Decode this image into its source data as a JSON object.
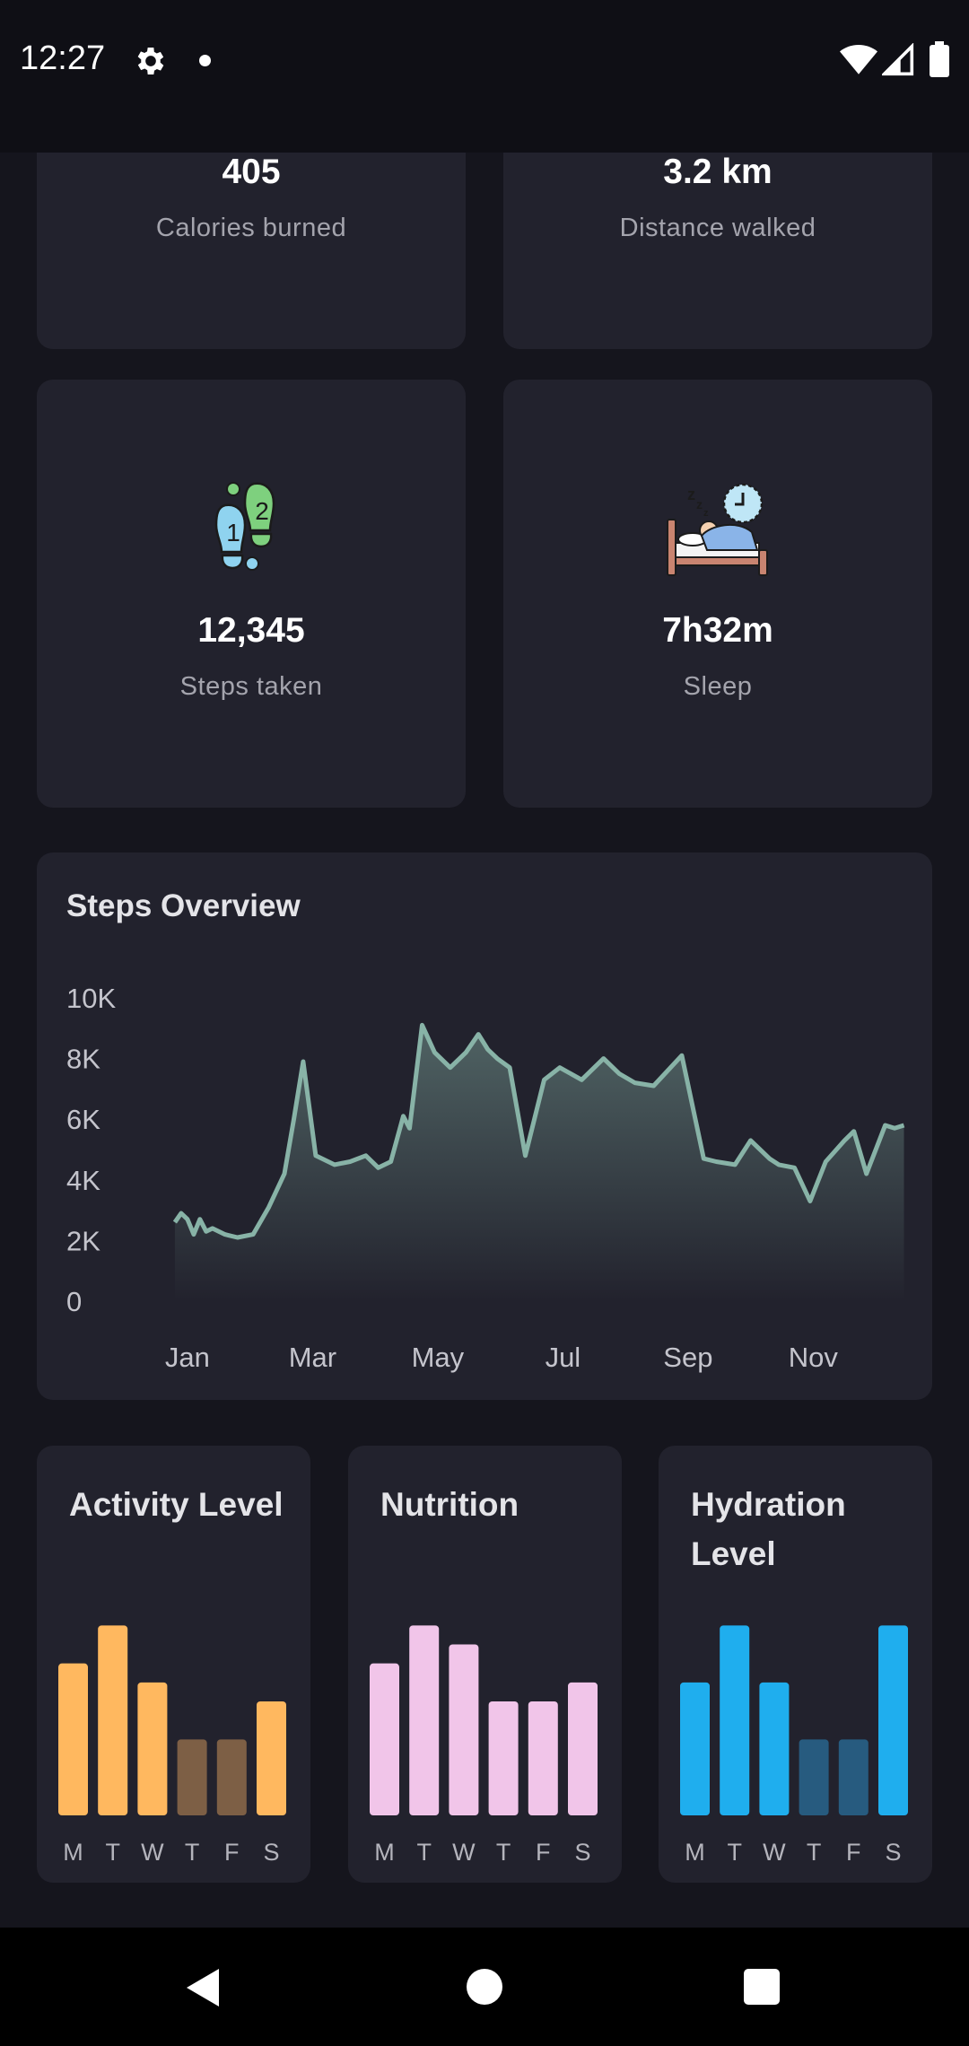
{
  "status_bar": {
    "time": "12:27",
    "icons": [
      "gear-icon",
      "notification-dot",
      "wifi-icon",
      "signal-icon",
      "battery-icon"
    ]
  },
  "stats": {
    "calories": {
      "value": "405",
      "label": "Calories burned"
    },
    "distance": {
      "value": "3.2 km",
      "label": "Distance walked"
    },
    "steps": {
      "value": "12,345",
      "label": "Steps taken",
      "icon": "footsteps-icon"
    },
    "sleep": {
      "value": "7h32m",
      "label": "Sleep",
      "icon": "sleep-bed-icon"
    }
  },
  "steps_overview": {
    "title": "Steps Overview",
    "chart_data": {
      "type": "area",
      "ylim": [
        0,
        10000
      ],
      "y_ticks": [
        0,
        2000,
        4000,
        6000,
        8000,
        10000
      ],
      "y_tick_labels": [
        "0",
        "2K",
        "4K",
        "6K",
        "8K",
        "10K"
      ],
      "x_tick_labels": [
        "Jan",
        "Mar",
        "May",
        "Jul",
        "Sep",
        "Nov"
      ],
      "x_tick_positions": [
        0.0,
        2.0,
        4.0,
        6.0,
        8.0,
        10.0
      ],
      "xlim": [
        -0.4,
        11.5
      ],
      "grid": false,
      "legend": "none",
      "line_color": "#88b3a7",
      "x": [
        -0.2,
        -0.1,
        0.0,
        0.1,
        0.2,
        0.3,
        0.4,
        0.6,
        0.8,
        1.05,
        1.3,
        1.55,
        1.7,
        1.85,
        2.05,
        2.35,
        2.6,
        2.85,
        3.05,
        3.25,
        3.45,
        3.55,
        3.75,
        3.95,
        4.2,
        4.45,
        4.65,
        4.8,
        4.95,
        5.15,
        5.4,
        5.7,
        5.95,
        6.3,
        6.65,
        6.9,
        7.15,
        7.45,
        7.9,
        8.25,
        8.45,
        8.75,
        9.0,
        9.3,
        9.45,
        9.7,
        9.95,
        10.2,
        10.5,
        10.65,
        10.85,
        11.15,
        11.3,
        11.45
      ],
      "y": [
        2600,
        2900,
        2700,
        2200,
        2700,
        2300,
        2400,
        2200,
        2100,
        2200,
        3100,
        4200,
        6000,
        7900,
        4800,
        4500,
        4600,
        4800,
        4400,
        4600,
        6100,
        5700,
        9100,
        8200,
        7700,
        8200,
        8800,
        8300,
        8000,
        7700,
        4800,
        7300,
        7700,
        7300,
        8000,
        7500,
        7200,
        7100,
        8100,
        4700,
        4600,
        4500,
        5300,
        4700,
        4500,
        4400,
        3300,
        4600,
        5300,
        5600,
        4200,
        5800,
        5700,
        5800
      ]
    }
  },
  "mini_charts": [
    {
      "title": "Activity Level",
      "chart_data": {
        "type": "bar",
        "categories": [
          "M",
          "T",
          "W",
          "T",
          "F",
          "S"
        ],
        "values": [
          8,
          10,
          7,
          4,
          4,
          6
        ],
        "highlighted": [
          true,
          true,
          true,
          false,
          false,
          true
        ],
        "ylim": [
          0,
          12
        ]
      },
      "colors": {
        "active": "#ffb85f",
        "muted": "#7d5f45"
      }
    },
    {
      "title": "Nutrition",
      "chart_data": {
        "type": "bar",
        "categories": [
          "M",
          "T",
          "W",
          "T",
          "F",
          "S"
        ],
        "values": [
          8,
          10,
          9,
          6,
          6,
          7
        ],
        "highlighted": [
          true,
          true,
          true,
          true,
          true,
          true
        ],
        "ylim": [
          0,
          12
        ]
      },
      "colors": {
        "active": "#f1c5e9",
        "muted": "#f1c5e9"
      }
    },
    {
      "title": "Hydration Level",
      "chart_data": {
        "type": "bar",
        "categories": [
          "M",
          "T",
          "W",
          "T",
          "F",
          "S"
        ],
        "values": [
          7,
          10,
          7,
          4,
          4,
          10
        ],
        "highlighted": [
          true,
          true,
          true,
          false,
          false,
          true
        ],
        "ylim": [
          0,
          12
        ]
      },
      "colors": {
        "active": "#1faeee",
        "muted": "#275b7f"
      }
    }
  ],
  "nav_bar": {
    "icons": [
      "back-icon",
      "home-icon",
      "recents-icon"
    ]
  }
}
